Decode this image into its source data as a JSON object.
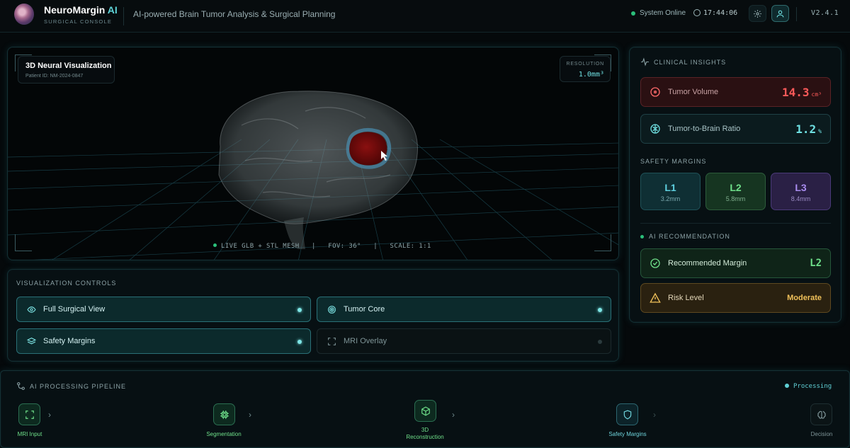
{
  "header": {
    "brand_main": "NeuroMargin",
    "brand_accent": "AI",
    "brand_sub": "SURGICAL CONSOLE",
    "tagline": "AI-powered Brain Tumor Analysis & Surgical Planning",
    "system_status": "System Online",
    "clock": "17:44:06",
    "version": "V2.4.1",
    "icons": [
      "brain-logo",
      "clock-icon",
      "gear-icon",
      "user-icon"
    ]
  },
  "viewer": {
    "title": "3D Neural Visualization",
    "patient_id": "Patient ID: NM-2024-0847",
    "resolution_label": "RESOLUTION",
    "resolution_value": "1.0mm³",
    "status_line": "LIVE GLB + STL MESH   |   FOV: 36°   |   SCALE: 1:1"
  },
  "controls": {
    "title": "VISUALIZATION CONTROLS",
    "items": [
      {
        "label": "Full Surgical View",
        "icon": "eye-icon",
        "active": true
      },
      {
        "label": "Tumor Core",
        "icon": "target-icon",
        "active": true
      },
      {
        "label": "Safety Margins",
        "icon": "layers-icon",
        "active": true
      },
      {
        "label": "MRI Overlay",
        "icon": "scan-icon",
        "active": false
      }
    ]
  },
  "insights": {
    "title": "CLINICAL INSIGHTS",
    "tumor_volume": {
      "label": "Tumor Volume",
      "value": "14.3",
      "unit": "cm³"
    },
    "tumor_ratio": {
      "label": "Tumor-to-Brain Ratio",
      "value": "1.2",
      "unit": "%"
    },
    "margins_title": "SAFETY MARGINS",
    "margins": [
      {
        "level": "L1",
        "value": "3.2mm"
      },
      {
        "level": "L2",
        "value": "5.8mm"
      },
      {
        "level": "L3",
        "value": "8.4mm"
      }
    ],
    "recommendation_title": "AI RECOMMENDATION",
    "recommended": {
      "label": "Recommended Margin",
      "value": "L2"
    },
    "risk": {
      "label": "Risk Level",
      "value": "Moderate"
    }
  },
  "pipeline": {
    "title": "AI PROCESSING PIPELINE",
    "status": "Processing",
    "steps": [
      {
        "label": "MRI Input",
        "icon": "scan-icon"
      },
      {
        "label": "Segmentation",
        "icon": "chip-icon"
      },
      {
        "label": "3D\nReconstruction",
        "icon": "cube-icon"
      },
      {
        "label": "Safety Margins",
        "icon": "shield-icon"
      },
      {
        "label": "Decision",
        "icon": "brain-icon"
      }
    ]
  },
  "colors": {
    "accent": "#5fd4d8",
    "tumor_red": "#ff5a5a",
    "ratio_cyan": "#6fe0e2",
    "l1": "#5fd0e0",
    "l2": "#6fe08a",
    "l3": "#a98cf0",
    "moderate": "#f0c15a"
  }
}
